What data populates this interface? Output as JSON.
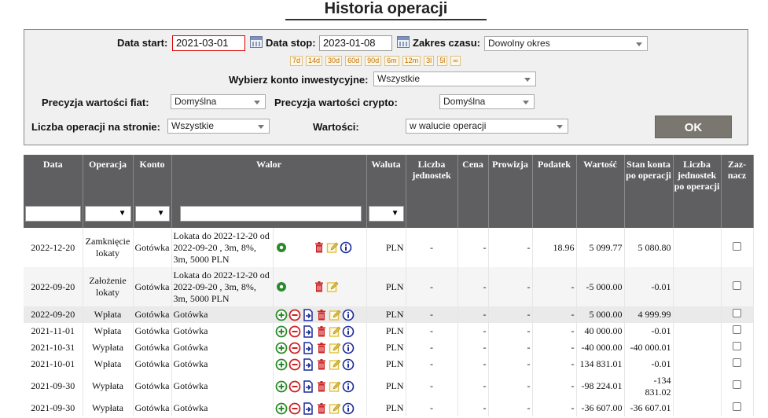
{
  "page_title": "Historia operacji",
  "filters": {
    "data_start_label": "Data start:",
    "data_start_value": "2021-03-01",
    "data_stop_label": "Data stop:",
    "data_stop_value": "2023-01-08",
    "zakres_label": "Zakres czasu:",
    "zakres_value": "Dowolny okres",
    "ranges": [
      "7d",
      "14d",
      "30d",
      "60d",
      "90d",
      "6m",
      "12m",
      "3l",
      "5l",
      "∞"
    ],
    "konto_label": "Wybierz konto inwestycyjne:",
    "konto_value": "Wszystkie",
    "fiat_label": "Precyzja wartości fiat:",
    "fiat_value": "Domyślna",
    "crypto_label": "Precyzja wartości crypto:",
    "crypto_value": "Domyślna",
    "liczba_label": "Liczba operacji na stronie:",
    "liczba_value": "Wszystkie",
    "wartosci_label": "Wartości:",
    "wartosci_value": "w walucie operacji",
    "ok_label": "OK"
  },
  "table": {
    "headers": {
      "data": "Data",
      "operacja": "Operacja",
      "konto": "Konto",
      "walor": "Walor",
      "waluta": "Waluta",
      "liczba_jedn": "Liczba jednostek",
      "cena": "Cena",
      "prowizja": "Prowizja",
      "podatek": "Podatek",
      "wartosc": "Wartość",
      "stan": "Stan konta po operacji",
      "liczba_po": "Liczba jednostek po operacji",
      "zaznacz": "Zaz-nacz"
    },
    "rows": [
      {
        "data": "2022-12-20",
        "operacja": "Zamknięcie lokaty",
        "konto": "Gotówka",
        "walor": "Lokata do 2022-12-20 od 2022-09-20 , 3m, 8%, 3m, 5000 PLN",
        "waluta": "PLN",
        "liczba": "-",
        "cena": "-",
        "prowizja": "-",
        "podatek": "18.96",
        "wartosc": "5 099.77",
        "stan": "5 080.80",
        "liczba_po": ""
      },
      {
        "data": "2022-09-20",
        "operacja": "Założenie lokaty",
        "konto": "Gotówka",
        "walor": "Lokata do 2022-12-20 od 2022-09-20 , 3m, 8%, 3m, 5000 PLN",
        "waluta": "PLN",
        "liczba": "-",
        "cena": "-",
        "prowizja": "-",
        "podatek": "-",
        "wartosc": "-5 000.00",
        "stan": "-0.01",
        "liczba_po": ""
      },
      {
        "data": "2022-09-20",
        "operacja": "Wpłata",
        "konto": "Gotówka",
        "walor": "Gotówka",
        "waluta": "PLN",
        "liczba": "-",
        "cena": "-",
        "prowizja": "-",
        "podatek": "-",
        "wartosc": "5 000.00",
        "stan": "4 999.99",
        "liczba_po": ""
      },
      {
        "data": "2021-11-01",
        "operacja": "Wpłata",
        "konto": "Gotówka",
        "walor": "Gotówka",
        "waluta": "PLN",
        "liczba": "-",
        "cena": "-",
        "prowizja": "-",
        "podatek": "-",
        "wartosc": "40 000.00",
        "stan": "-0.01",
        "liczba_po": ""
      },
      {
        "data": "2021-10-31",
        "operacja": "Wypłata",
        "konto": "Gotówka",
        "walor": "Gotówka",
        "waluta": "PLN",
        "liczba": "-",
        "cena": "-",
        "prowizja": "-",
        "podatek": "-",
        "wartosc": "-40 000.00",
        "stan": "-40 000.01",
        "liczba_po": ""
      },
      {
        "data": "2021-10-01",
        "operacja": "Wpłata",
        "konto": "Gotówka",
        "walor": "Gotówka",
        "waluta": "PLN",
        "liczba": "-",
        "cena": "-",
        "prowizja": "-",
        "podatek": "-",
        "wartosc": "134 831.01",
        "stan": "-0.01",
        "liczba_po": ""
      },
      {
        "data": "2021-09-30",
        "operacja": "Wypłata",
        "konto": "Gotówka",
        "walor": "Gotówka",
        "waluta": "PLN",
        "liczba": "-",
        "cena": "-",
        "prowizja": "-",
        "podatek": "-",
        "wartosc": "-98 224.01",
        "stan": "-134 831.02",
        "liczba_po": ""
      },
      {
        "data": "2021-09-30",
        "operacja": "Wypłata",
        "konto": "Gotówka",
        "walor": "Gotówka",
        "waluta": "PLN",
        "liczba": "-",
        "cena": "-",
        "prowizja": "-",
        "podatek": "-",
        "wartosc": "-36 607.00",
        "stan": "-36 607.01",
        "liczba_po": ""
      }
    ]
  },
  "colors": {
    "header_bg": "#5f5f62",
    "ok_bg": "#7a7670",
    "range_text": "#c07000",
    "icon_green": "#2a8a2a",
    "icon_red": "#cc2222",
    "icon_blue": "#1a2a9a",
    "icon_edit": "#e0c040"
  },
  "icons": [
    "circle-dot-icon",
    "plus-circle-icon",
    "minus-circle-icon",
    "transfer-doc-icon",
    "trash-icon",
    "edit-icon",
    "info-icon",
    "calendar-icon"
  ]
}
